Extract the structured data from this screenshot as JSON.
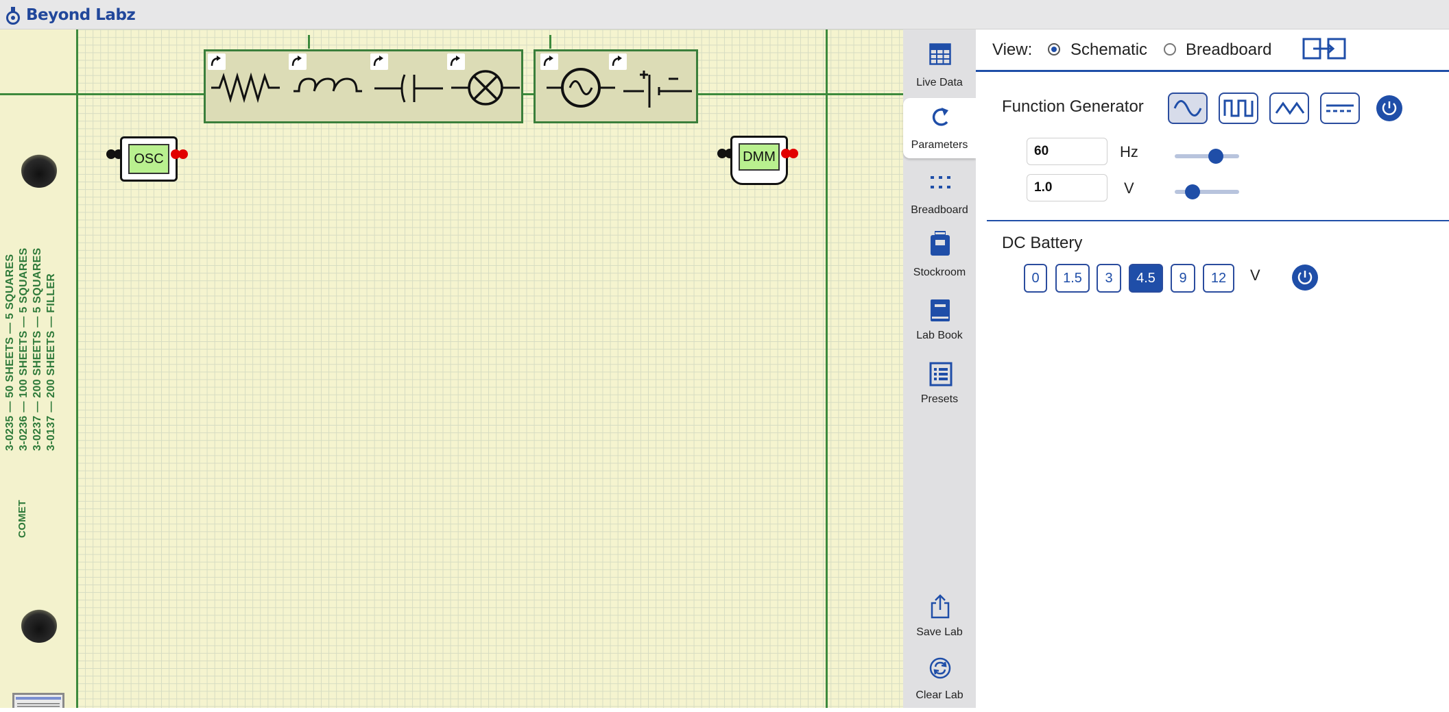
{
  "app": {
    "brand": "Beyond Labz"
  },
  "canvas": {
    "paper_text": {
      "line1": "3-0235 — 50 SHEETS — 5 SQUARES",
      "line2": "3-0236 — 100 SHEETS — 5 SQUARES",
      "line3": "3-0237 — 200 SHEETS — 5 SQUARES",
      "line4": "3-0137 — 200 SHEETS — FILLER",
      "brand": "COMET"
    },
    "components_passive": [
      "resistor-icon",
      "inductor-icon",
      "capacitor-icon",
      "lamp-icon"
    ],
    "components_sources": [
      "ac-source-icon",
      "battery-icon"
    ],
    "osc_label": "OSC",
    "dmm_label": "DMM"
  },
  "nav": {
    "items": [
      {
        "label": "Live Data",
        "icon": "table-icon"
      },
      {
        "label": "Parameters",
        "icon": "rotate-icon"
      },
      {
        "label": "Breadboard",
        "icon": "dots-icon"
      },
      {
        "label": "Stockroom",
        "icon": "jar-icon"
      },
      {
        "label": "Lab Book",
        "icon": "book-icon"
      },
      {
        "label": "Presets",
        "icon": "list-icon"
      },
      {
        "label": "Save Lab",
        "icon": "share-icon"
      },
      {
        "label": "Clear Lab",
        "icon": "refresh-icon"
      }
    ],
    "active": "Parameters"
  },
  "view": {
    "label": "View:",
    "options": [
      "Schematic",
      "Breadboard"
    ],
    "selected": "Schematic"
  },
  "function_generator": {
    "title": "Function Generator",
    "waveforms": [
      "sine",
      "square",
      "triangle",
      "dc"
    ],
    "selected_waveform": "sine",
    "frequency_value": "60",
    "frequency_unit": "Hz",
    "frequency_slider_fraction": 0.64,
    "amplitude_value": "1.0",
    "amplitude_unit": "V",
    "amplitude_slider_fraction": 0.28
  },
  "dc_battery": {
    "title": "DC Battery",
    "options": [
      "0",
      "1.5",
      "3",
      "4.5",
      "9",
      "12"
    ],
    "selected": "4.5",
    "unit": "V"
  },
  "colors": {
    "accent": "#1f4ea8",
    "paper": "#f5f4cf",
    "grid_line": "#3d8a3d"
  }
}
